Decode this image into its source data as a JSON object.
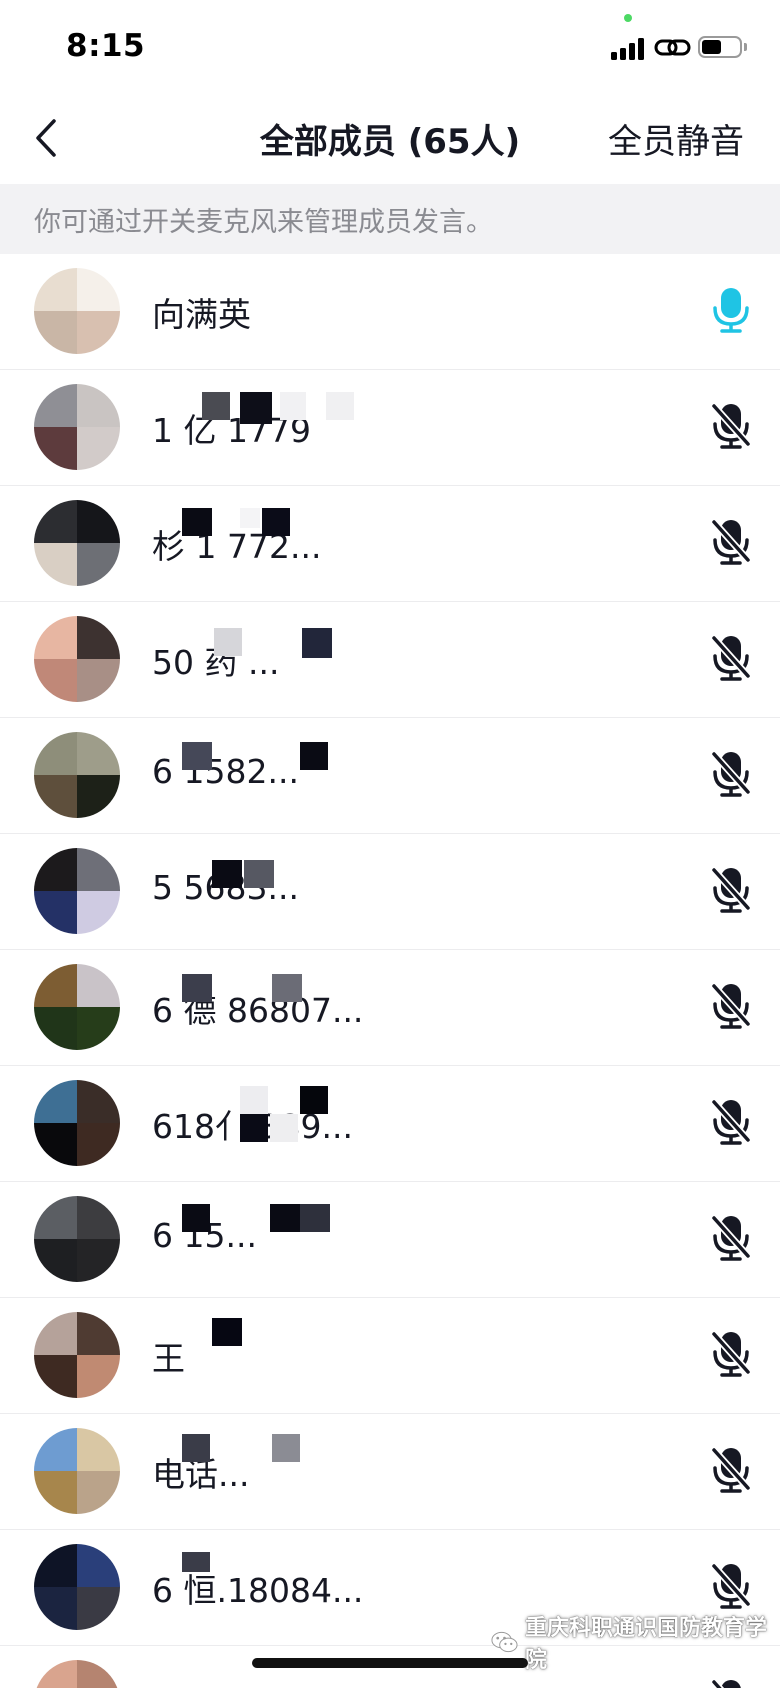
{
  "status_bar": {
    "time": "8:15"
  },
  "header": {
    "title": "全部成员 (65人)",
    "mute_all_label": "全员静音",
    "back_icon": "chevron-left-icon"
  },
  "tip": {
    "text": "你可通过开关麦克风来管理成员发言。"
  },
  "colors": {
    "mic_active": "#1fc4e4",
    "mic_muted": "#161823",
    "tip_background": "#f2f2f4"
  },
  "members": [
    {
      "name": "向满英",
      "mic": "on"
    },
    {
      "name": "1 亿 1779",
      "mic": "muted"
    },
    {
      "name": "杉 1 772...",
      "mic": "muted"
    },
    {
      "name": "50 药 ...",
      "mic": "muted"
    },
    {
      "name": "6 1582...",
      "mic": "muted"
    },
    {
      "name": "5 5683...",
      "mic": "muted"
    },
    {
      "name": "6 德 86807...",
      "mic": "muted"
    },
    {
      "name": "618亻 389...",
      "mic": "muted"
    },
    {
      "name": "6 15...",
      "mic": "muted"
    },
    {
      "name": "王",
      "mic": "muted"
    },
    {
      "name": "电话...",
      "mic": "muted"
    },
    {
      "name": "6 恒.18084...",
      "mic": "muted"
    },
    {
      "name": "",
      "mic": "muted"
    }
  ],
  "watermark": {
    "text": "重庆科职通识国防教育学院",
    "icon": "wechat-icon"
  }
}
